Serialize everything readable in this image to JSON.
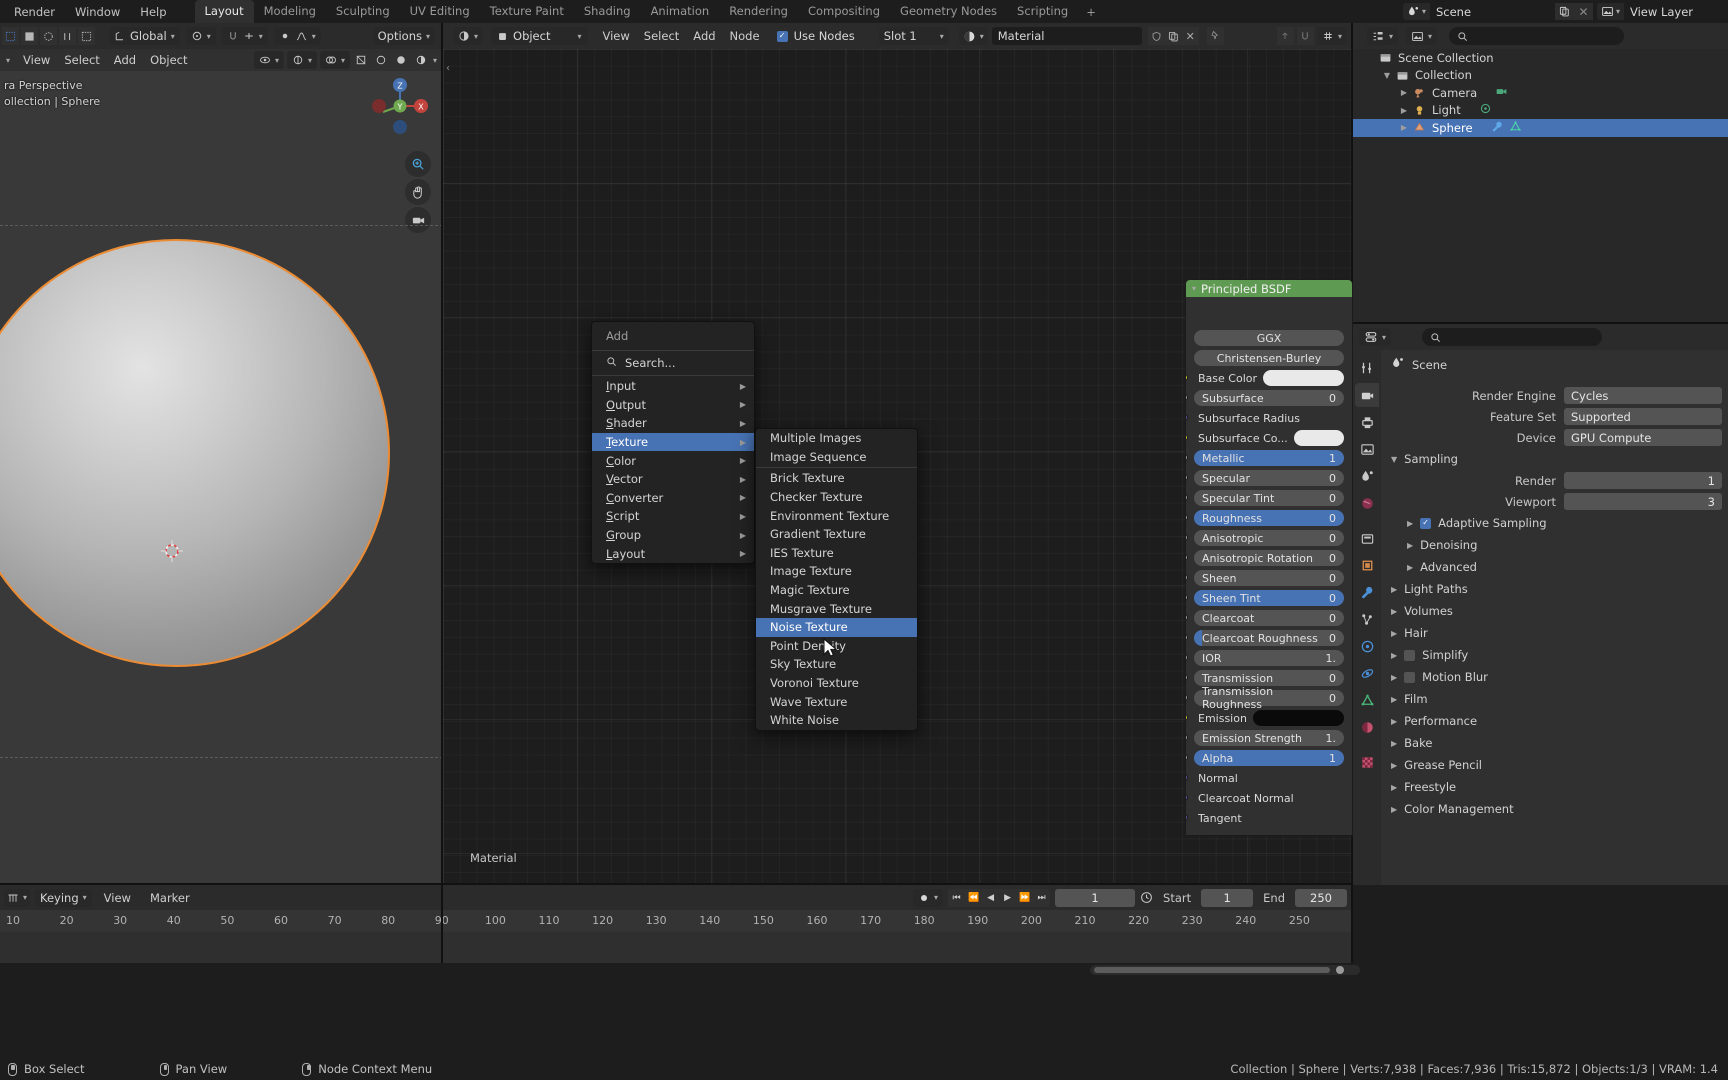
{
  "topbar": {
    "menus": [
      "Render",
      "Window",
      "Help"
    ],
    "workspaces": [
      "Layout",
      "Modeling",
      "Sculpting",
      "UV Editing",
      "Texture Paint",
      "Shading",
      "Animation",
      "Rendering",
      "Compositing",
      "Geometry Nodes",
      "Scripting"
    ],
    "active_workspace": "Layout",
    "add_workspace": "+",
    "scene_name": "Scene",
    "view_layer_name": "View Layer"
  },
  "viewport3d_header": {
    "orientation": "Global",
    "options": "Options",
    "menus": [
      "View",
      "Select",
      "Add",
      "Object"
    ]
  },
  "shader_header": {
    "mode": "Object",
    "menus": [
      "View",
      "Select",
      "Add",
      "Node"
    ],
    "use_nodes_label": "Use Nodes",
    "use_nodes_checked": true,
    "slot": "Slot 1",
    "material_name": "Material"
  },
  "viewport3d": {
    "overlay_line1": "ra Perspective",
    "overlay_line2": "ollection | Sphere",
    "gizmo_axes": [
      "Z",
      "Y",
      "X"
    ]
  },
  "shader_editor": {
    "footer_label": "Material"
  },
  "add_menu": {
    "title": "Add",
    "search": "Search...",
    "items": [
      {
        "label": "Input",
        "submenu": true,
        "selected": false
      },
      {
        "label": "Output",
        "submenu": true,
        "selected": false
      },
      {
        "label": "Shader",
        "submenu": true,
        "selected": false
      },
      {
        "label": "Texture",
        "submenu": true,
        "selected": true
      },
      {
        "label": "Color",
        "submenu": true,
        "selected": false
      },
      {
        "label": "Vector",
        "submenu": true,
        "selected": false
      },
      {
        "label": "Converter",
        "submenu": true,
        "selected": false
      },
      {
        "label": "Script",
        "submenu": true,
        "selected": false
      },
      {
        "label": "Group",
        "submenu": true,
        "selected": false
      },
      {
        "label": "Layout",
        "submenu": true,
        "selected": false
      }
    ]
  },
  "texture_submenu": {
    "group1": [
      "Multiple Images",
      "Image Sequence"
    ],
    "group2": [
      {
        "label": "Brick Texture",
        "selected": false
      },
      {
        "label": "Checker Texture",
        "selected": false
      },
      {
        "label": "Environment Texture",
        "selected": false
      },
      {
        "label": "Gradient Texture",
        "selected": false
      },
      {
        "label": "IES Texture",
        "selected": false
      },
      {
        "label": "Image Texture",
        "selected": false
      },
      {
        "label": "Magic Texture",
        "selected": false
      },
      {
        "label": "Musgrave Texture",
        "selected": false
      },
      {
        "label": "Noise Texture",
        "selected": true
      },
      {
        "label": "Point Density",
        "selected": false
      },
      {
        "label": "Sky Texture",
        "selected": false
      },
      {
        "label": "Voronoi Texture",
        "selected": false
      },
      {
        "label": "Wave Texture",
        "selected": false
      },
      {
        "label": "White Noise",
        "selected": false
      }
    ]
  },
  "node": {
    "title": "Principled BSDF",
    "distribution": "GGX",
    "subsurface_method": "Christensen-Burley",
    "inputs": [
      {
        "label": "Base Color",
        "socket": "yellow",
        "type": "color",
        "value": ""
      },
      {
        "label": "Subsurface",
        "socket": "gray",
        "type": "number",
        "value": "0"
      },
      {
        "label": "Subsurface Radius",
        "socket": "purple",
        "type": "name",
        "value": ""
      },
      {
        "label": "Subsurface Co...",
        "socket": "yellow",
        "type": "color",
        "value": ""
      },
      {
        "label": "Metallic",
        "socket": "gray",
        "type": "blue",
        "value": "1"
      },
      {
        "label": "Specular",
        "socket": "gray",
        "type": "number",
        "value": "0"
      },
      {
        "label": "Specular Tint",
        "socket": "gray",
        "type": "number",
        "value": "0"
      },
      {
        "label": "Roughness",
        "socket": "gray",
        "type": "blue",
        "value": "0"
      },
      {
        "label": "Anisotropic",
        "socket": "gray",
        "type": "number",
        "value": "0"
      },
      {
        "label": "Anisotropic Rotation",
        "socket": "gray",
        "type": "number",
        "value": "0"
      },
      {
        "label": "Sheen",
        "socket": "gray",
        "type": "number",
        "value": "0"
      },
      {
        "label": "Sheen Tint",
        "socket": "gray",
        "type": "blue",
        "value": "0"
      },
      {
        "label": "Clearcoat",
        "socket": "gray",
        "type": "number",
        "value": "0"
      },
      {
        "label": "Clearcoat Roughness",
        "socket": "gray",
        "type": "slider",
        "value": "0"
      },
      {
        "label": "IOR",
        "socket": "gray",
        "type": "number",
        "value": "1."
      },
      {
        "label": "Transmission",
        "socket": "gray",
        "type": "number",
        "value": "0"
      },
      {
        "label": "Transmission Roughness",
        "socket": "gray",
        "type": "number",
        "value": "0"
      },
      {
        "label": "Emission",
        "socket": "green",
        "type": "colorblack",
        "value": ""
      },
      {
        "label": "Emission Strength",
        "socket": "gray",
        "type": "number",
        "value": "1."
      },
      {
        "label": "Alpha",
        "socket": "gray",
        "type": "blue",
        "value": "1"
      },
      {
        "label": "Normal",
        "socket": "purple",
        "type": "name",
        "value": ""
      },
      {
        "label": "Clearcoat Normal",
        "socket": "purple",
        "type": "name",
        "value": ""
      },
      {
        "label": "Tangent",
        "socket": "purple",
        "type": "name",
        "value": ""
      }
    ]
  },
  "outliner": {
    "rows": [
      {
        "label": "Scene Collection",
        "icon": "collection-icon",
        "depth": 0,
        "expander": "",
        "selected": false,
        "badges": []
      },
      {
        "label": "Collection",
        "icon": "collection-icon",
        "depth": 1,
        "expander": "▼",
        "selected": false,
        "badges": []
      },
      {
        "label": "Camera",
        "icon": "camera-icon",
        "depth": 2,
        "expander": "▶",
        "selected": false,
        "badges": [
          "camera-data-icon"
        ]
      },
      {
        "label": "Light",
        "icon": "light-icon",
        "depth": 2,
        "expander": "▶",
        "selected": false,
        "badges": [
          "light-data-icon"
        ]
      },
      {
        "label": "Sphere",
        "icon": "mesh-icon",
        "depth": 2,
        "expander": "▶",
        "selected": true,
        "badges": [
          "modifier-icon",
          "mesh-data-icon"
        ]
      }
    ]
  },
  "properties": {
    "breadcrumb": "Scene",
    "rows": [
      {
        "label": "Render Engine",
        "value": "Cycles"
      },
      {
        "label": "Feature Set",
        "value": "Supported"
      },
      {
        "label": "Device",
        "value": "GPU Compute"
      }
    ],
    "sampling": {
      "title": "Sampling",
      "render_label": "Render",
      "render_value": "1",
      "viewport_label": "Viewport",
      "viewport_value": "3",
      "sub_sections": [
        {
          "label": "Adaptive Sampling",
          "checkbox": true,
          "checked": true
        },
        {
          "label": "Denoising",
          "checkbox": false,
          "checked": false
        },
        {
          "label": "Advanced",
          "checkbox": false,
          "checked": false
        }
      ]
    },
    "sections": [
      {
        "label": "Light Paths",
        "checkbox": false,
        "checked": false
      },
      {
        "label": "Volumes",
        "checkbox": false,
        "checked": false
      },
      {
        "label": "Hair",
        "checkbox": false,
        "checked": false
      },
      {
        "label": "Simplify",
        "checkbox": true,
        "checked": false
      },
      {
        "label": "Motion Blur",
        "checkbox": true,
        "checked": false
      },
      {
        "label": "Film",
        "checkbox": false,
        "checked": false
      },
      {
        "label": "Performance",
        "checkbox": false,
        "checked": false
      },
      {
        "label": "Bake",
        "checkbox": false,
        "checked": false
      },
      {
        "label": "Grease Pencil",
        "checkbox": false,
        "checked": false
      },
      {
        "label": "Freestyle",
        "checkbox": false,
        "checked": false
      },
      {
        "label": "Color Management",
        "checkbox": false,
        "checked": false
      }
    ]
  },
  "timeline": {
    "editor_mode": "Keying",
    "menus": [
      "View",
      "Marker"
    ],
    "ticks": [
      "10",
      "20",
      "30",
      "40",
      "50",
      "60",
      "70",
      "80",
      "90",
      "100",
      "110",
      "120",
      "130",
      "140",
      "150",
      "160",
      "170",
      "180",
      "190",
      "200",
      "210",
      "220",
      "230",
      "240",
      "250"
    ],
    "current_frame": "1",
    "start_label": "Start",
    "start_value": "1",
    "end_label": "End",
    "end_value": "250"
  },
  "statusbar": {
    "hints": [
      {
        "label": "Box Select",
        "icon": "mouse-left-icon"
      },
      {
        "label": "Pan View",
        "icon": "mouse-middle-icon"
      },
      {
        "label": "Node Context Menu",
        "icon": "mouse-right-icon"
      }
    ],
    "stats": "Collection | Sphere | Verts:7,938 | Faces:7,936 | Tris:15,872 | Objects:1/3 | VRAM: 1.4"
  },
  "colors": {
    "accent_blue": "#4772b3",
    "node_header_green": "#5f9a52",
    "selection_orange": "#eb8c34"
  }
}
